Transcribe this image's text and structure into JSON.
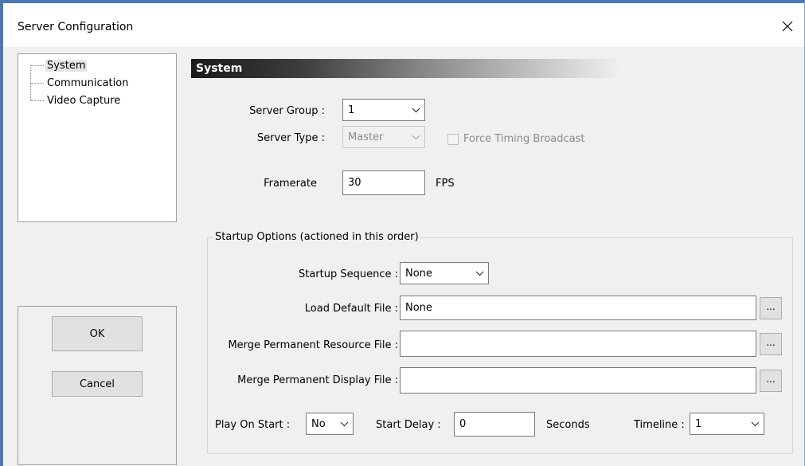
{
  "window": {
    "title": "Server Configuration",
    "close_glyph": "✕"
  },
  "tree": {
    "items": [
      {
        "label": "System",
        "selected": true
      },
      {
        "label": "Communication",
        "selected": false
      },
      {
        "label": "Video Capture",
        "selected": false
      }
    ]
  },
  "buttons": {
    "ok_label": "OK",
    "cancel_label": "Cancel"
  },
  "section": {
    "title": "System"
  },
  "system": {
    "server_group_label": "Server Group :",
    "server_group_value": "1",
    "server_type_label": "Server Type :",
    "server_type_value": "Master",
    "force_timing_label": "Force Timing Broadcast",
    "framerate_label": "Framerate",
    "framerate_value": "30",
    "framerate_unit": "FPS"
  },
  "startup": {
    "group_title": "Startup Options (actioned in this order)",
    "sequence_label": "Startup Sequence :",
    "sequence_value": "None",
    "load_default_label": "Load Default File :",
    "load_default_value": "None",
    "merge_resource_label": "Merge Permanent Resource File :",
    "merge_resource_value": "",
    "merge_display_label": "Merge Permanent Display File :",
    "merge_display_value": "",
    "browse_label": "...",
    "play_on_start_label": "Play On Start :",
    "play_on_start_value": "No",
    "start_delay_label": "Start Delay :",
    "start_delay_value": "0",
    "start_delay_unit": "Seconds",
    "timeline_label": "Timeline :",
    "timeline_value": "1"
  },
  "colors": {
    "window_border": "#4a78b5",
    "header_dark": "#1a1a1a",
    "dialog_bg": "#f0f0f0"
  }
}
